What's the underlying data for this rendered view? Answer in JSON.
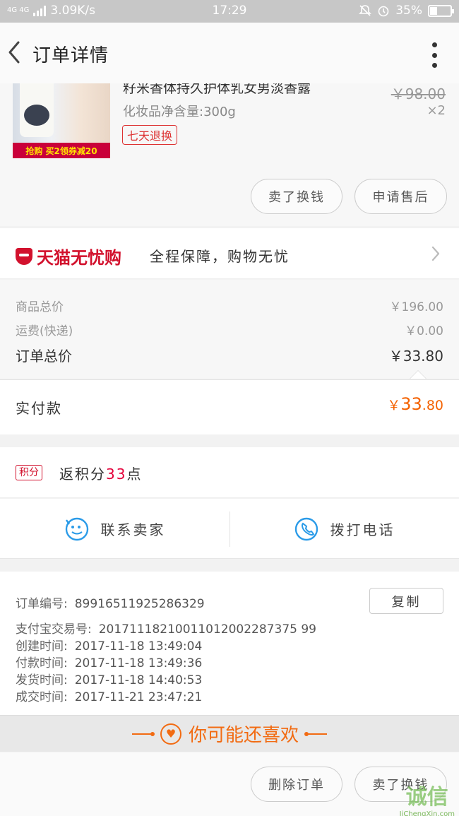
{
  "status_bar": {
    "network": "4G 4G",
    "speed": "3.09K/s",
    "time": "17:29",
    "battery": "35%",
    "battery_level": 0.35
  },
  "header": {
    "title": "订单详情"
  },
  "product": {
    "name": "籽米香体持久护体乳女男淡香露",
    "spec": "化妆品净含量:300g",
    "original_price": "￥98.00",
    "quantity": "×2",
    "tag": "七天退换",
    "promo_banner": "抢购 买2领券减20",
    "actions": [
      "卖了换钱",
      "申请售后"
    ]
  },
  "guarantee": {
    "brand": "天猫无忧购",
    "slogan": "全程保障，购物无忧"
  },
  "summary": {
    "goods_total_label": "商品总价",
    "goods_total_value": "￥196.00",
    "shipping_label": "运费(快递)",
    "shipping_value": "￥0.00",
    "order_total_label": "订单总价",
    "order_total_value": "￥33.80"
  },
  "payment": {
    "label": "实付款",
    "currency": "￥",
    "integer": "33",
    "decimal": ".80"
  },
  "points": {
    "badge": "积分",
    "prefix": "返积分",
    "value": "33",
    "suffix": "点"
  },
  "contacts": {
    "seller": "联系卖家",
    "phone": "拨打电话"
  },
  "order_info": {
    "order_no_label": "订单编号:",
    "order_no": "89916511925286329",
    "copy_label": "复制",
    "alipay_label": "支付宝交易号:",
    "alipay_no": "20171118210011012002287375 99",
    "created_label": "创建时间:",
    "created": "2017-11-18 13:49:04",
    "paid_label": "付款时间:",
    "paid": "2017-11-18 13:49:36",
    "shipped_label": "发货时间:",
    "shipped": "2017-11-18 14:40:53",
    "completed_label": "成交时间:",
    "completed": "2017-11-21 23:47:21"
  },
  "recommend": {
    "title": "你可能还喜欢"
  },
  "footer": {
    "actions": [
      "删除订单",
      "卖了换钱"
    ]
  },
  "watermark": {
    "main": "诚信",
    "sub": "JiChengXin.com"
  },
  "colors": {
    "brand_red": "#d2112d",
    "pay_orange": "#f46200",
    "recommend_orange": "#f26b12",
    "icon_blue": "#2b9be8"
  }
}
